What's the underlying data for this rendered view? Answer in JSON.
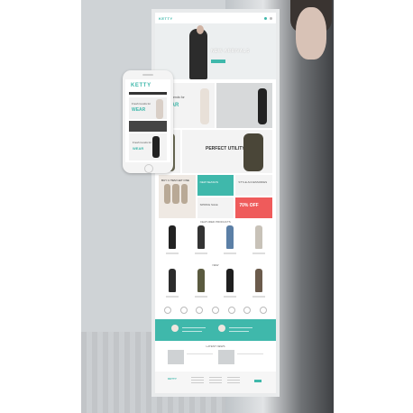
{
  "desktop": {
    "logo": "KETTY",
    "nav": [
      "",
      "",
      "",
      ""
    ],
    "hero_text": "NEW ARRIVALS",
    "banner_left_small": "Fresh trends for",
    "banner_left_big": "WEAR",
    "utility_title": "PERFECT UTILITY",
    "promo_left": "BUY 1 ITEM GET ONE",
    "promo_teal": "NEW SEASON",
    "promo_top_right": "STYLE ACCESSORIES",
    "promo_mid": "SPRING SALE",
    "promo_sale": "70% OFF",
    "featured_title": "FEATURED PRODUCTS",
    "new_title": "NEW",
    "blog_title": "LATEST NEWS",
    "footer_logo": "KETTY"
  },
  "phone": {
    "logo": "KETTY",
    "hero_small": "Fresh trends for",
    "hero_big": "WEAR",
    "card_small": "Fresh trends for",
    "card_big": "WEAR"
  },
  "colors": {
    "accent": "#3fb8ab",
    "sale": "#ef5b5b"
  }
}
